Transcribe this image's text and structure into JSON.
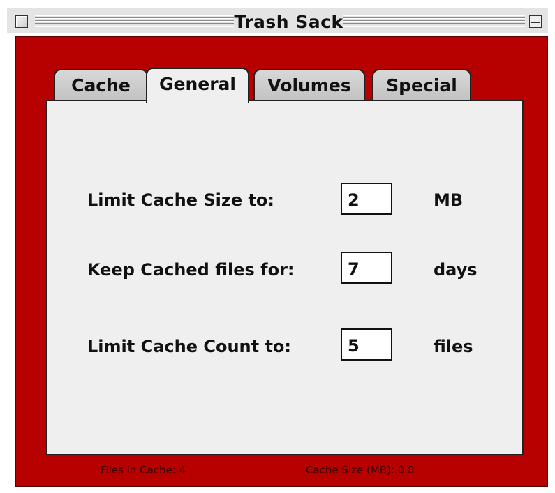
{
  "window": {
    "title": "Trash Sack"
  },
  "tabs": [
    {
      "label": "Cache",
      "active": false
    },
    {
      "label": "General",
      "active": true
    },
    {
      "label": "Volumes",
      "active": false
    },
    {
      "label": "Special",
      "active": false
    }
  ],
  "general": {
    "rows": [
      {
        "label": "Limit Cache Size to:",
        "value": "2",
        "unit": "MB"
      },
      {
        "label": "Keep Cached files for:",
        "value": "7",
        "unit": "days"
      },
      {
        "label": "Limit Cache Count to:",
        "value": "5",
        "unit": "files"
      }
    ]
  },
  "status": {
    "files_in_cache": "Files in Cache: 4",
    "cache_size": "Cache Size (MB):  0.8"
  },
  "colors": {
    "window_body": "#b70000",
    "panel": "#efefef",
    "title_bar": "#e4e4e4"
  }
}
